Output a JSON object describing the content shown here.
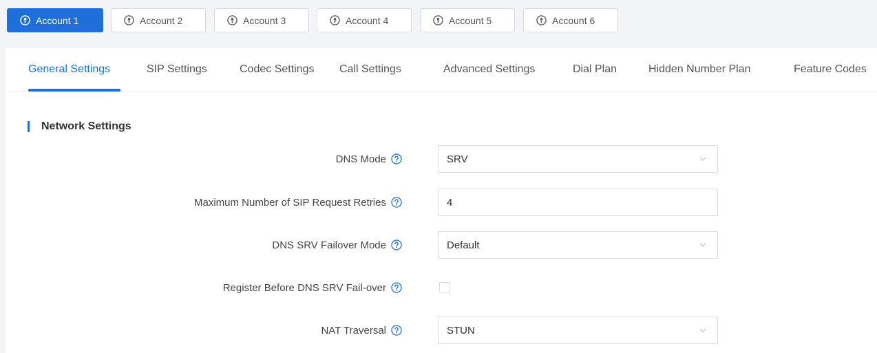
{
  "accounts": [
    {
      "label": "Account 1",
      "active": true
    },
    {
      "label": "Account 2",
      "active": false
    },
    {
      "label": "Account 3",
      "active": false
    },
    {
      "label": "Account 4",
      "active": false
    },
    {
      "label": "Account 5",
      "active": false
    },
    {
      "label": "Account 6",
      "active": false
    }
  ],
  "tabs": [
    {
      "label": "General Settings",
      "active": true
    },
    {
      "label": "SIP Settings"
    },
    {
      "label": "Codec Settings"
    },
    {
      "label": "Call Settings"
    },
    {
      "label": "Advanced Settings"
    },
    {
      "label": "Dial Plan"
    },
    {
      "label": "Hidden Number Plan"
    },
    {
      "label": "Feature Codes"
    }
  ],
  "section": {
    "title": "Network Settings"
  },
  "fields": {
    "dns_mode": {
      "label": "DNS Mode",
      "value": "SRV"
    },
    "max_retries": {
      "label": "Maximum Number of SIP Request Retries",
      "value": "4"
    },
    "dns_srv_failover": {
      "label": "DNS SRV Failover Mode",
      "value": "Default"
    },
    "register_before_failover": {
      "label": "Register Before DNS SRV Fail-over",
      "checked": false
    },
    "nat_traversal": {
      "label": "NAT Traversal",
      "value": "STUN"
    }
  },
  "colors": {
    "accent": "#1e6fd9",
    "background": "#f2f4f7"
  },
  "icons": {
    "account": "account-icon",
    "help": "help-icon",
    "dropdown": "chevron-down-icon"
  }
}
